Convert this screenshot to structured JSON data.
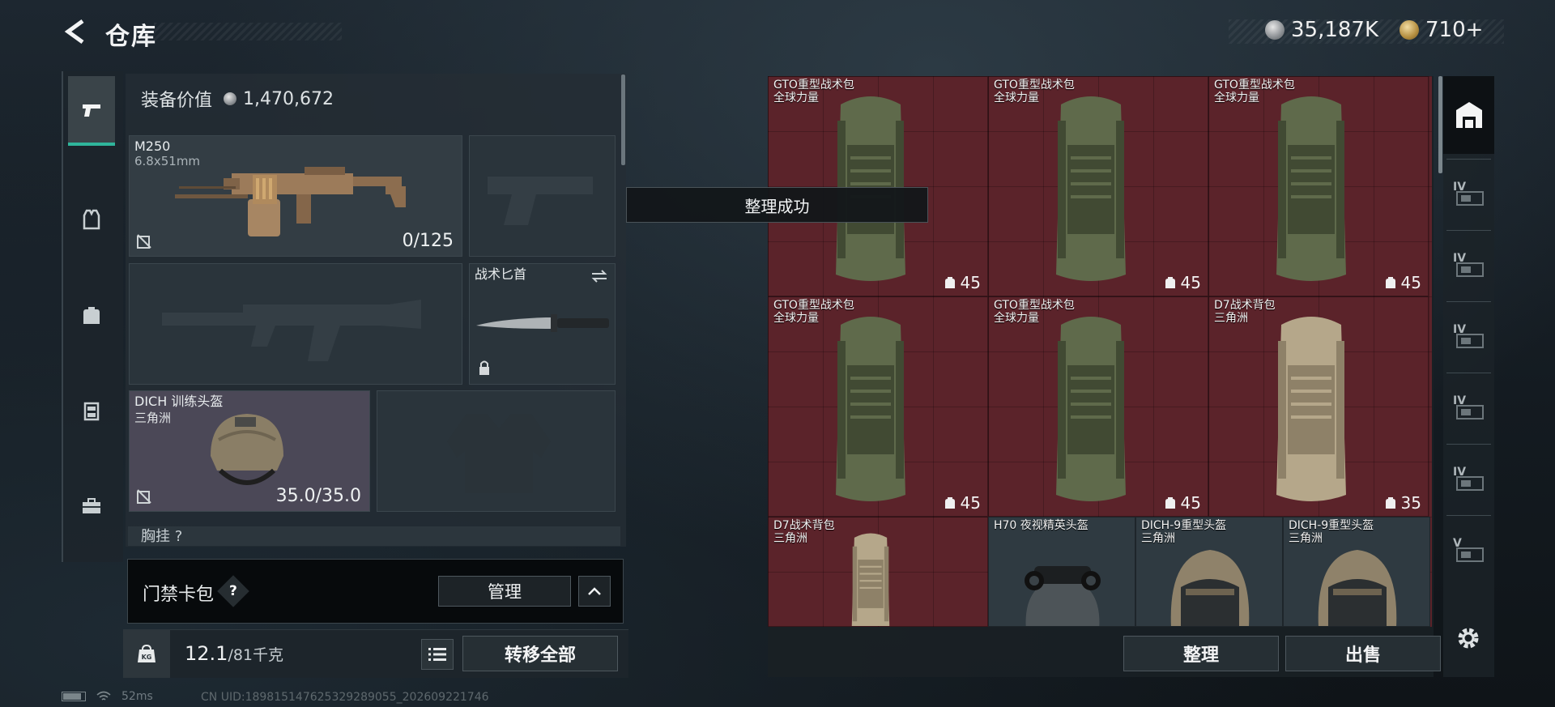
{
  "header": {
    "title": "仓库",
    "currency_silver": "35,187K",
    "currency_gold": "710+"
  },
  "tabs": [
    {
      "name": "weapons",
      "icon": "pistol-icon",
      "active": true
    },
    {
      "name": "vest",
      "icon": "vest-icon",
      "active": false
    },
    {
      "name": "backpack",
      "icon": "backpack-icon",
      "active": false
    },
    {
      "name": "chest-rig",
      "icon": "chest-rig-icon",
      "active": false
    },
    {
      "name": "toolbox",
      "icon": "toolbox-icon",
      "active": false
    }
  ],
  "equipment": {
    "value_label": "装备价值",
    "value": "1,470,672",
    "primary": {
      "name": "M250",
      "caliber": "6.8x51mm",
      "ammo": "0/125"
    },
    "melee": {
      "name": "战术匕首"
    },
    "helmet": {
      "name": "DICH 训练头盔",
      "sub": "三角洲",
      "durability": "35.0/35.0"
    },
    "pocket_label": "胸挂 ?"
  },
  "access_card": {
    "label": "门禁卡包",
    "help": "?",
    "manage_label": "管理"
  },
  "weight": {
    "current": "12.1",
    "max": "/81千克",
    "kg_icon_label": "KG",
    "transfer_label": "转移全部"
  },
  "toast": "整理成功",
  "storage": {
    "items": [
      {
        "name": "GTO重型战术包",
        "sub": "全球力量",
        "capacity": "45",
        "kind": "backpack-green"
      },
      {
        "name": "GTO重型战术包",
        "sub": "全球力量",
        "capacity": "45",
        "kind": "backpack-green"
      },
      {
        "name": "GTO重型战术包",
        "sub": "全球力量",
        "capacity": "45",
        "kind": "backpack-green"
      },
      {
        "name": "GTO重型战术包",
        "sub": "全球力量",
        "capacity": "45",
        "kind": "backpack-green"
      },
      {
        "name": "GTO重型战术包",
        "sub": "全球力量",
        "capacity": "45",
        "kind": "backpack-green"
      },
      {
        "name": "D7战术背包",
        "sub": "三角洲",
        "capacity": "35",
        "kind": "backpack-tan"
      },
      {
        "name": "D7战术背包",
        "sub": "三角洲",
        "capacity": "",
        "kind": "backpack-tan"
      },
      {
        "name": "H70 夜视精英头盔",
        "sub": "",
        "capacity": "",
        "kind": "helmet-nvg"
      },
      {
        "name": "DICH-9重型头盔",
        "sub": "三角洲",
        "capacity": "",
        "kind": "helmet-heavy"
      },
      {
        "name": "DICH-9重型头盔",
        "sub": "三角洲",
        "capacity": "",
        "kind": "helmet-heavy"
      }
    ],
    "sort_label": "整理",
    "sell_label": "出售"
  },
  "side_slots": [
    {
      "level": "IV"
    },
    {
      "level": "IV"
    },
    {
      "level": "IV"
    },
    {
      "level": "IV"
    },
    {
      "level": "IV"
    },
    {
      "level": "V"
    }
  ],
  "status": {
    "ping": "52ms",
    "uid": "CN UID:189815147625329289055_202609221746"
  },
  "colors": {
    "accent_teal": "#2fb59b",
    "grid_red": "#5b232a"
  }
}
